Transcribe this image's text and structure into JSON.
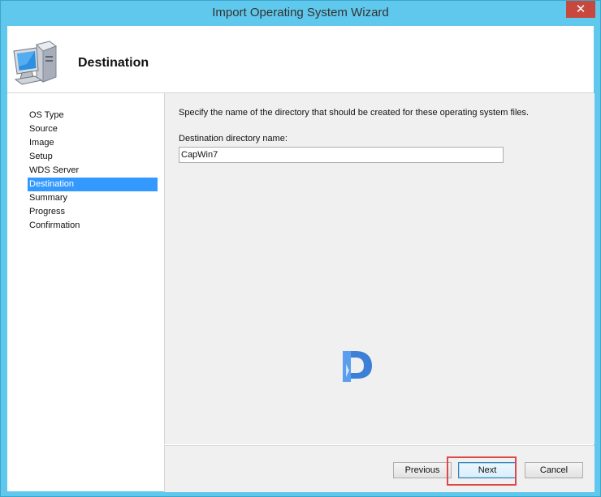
{
  "window": {
    "title": "Import Operating System Wizard",
    "close_glyph": "✕"
  },
  "header": {
    "title": "Destination",
    "icon": "computer-icon"
  },
  "nav": {
    "items": [
      {
        "label": "OS Type",
        "active": false
      },
      {
        "label": "Source",
        "active": false
      },
      {
        "label": "Image",
        "active": false
      },
      {
        "label": "Setup",
        "active": false
      },
      {
        "label": "WDS Server",
        "active": false
      },
      {
        "label": "Destination",
        "active": true
      },
      {
        "label": "Summary",
        "active": false
      },
      {
        "label": "Progress",
        "active": false
      },
      {
        "label": "Confirmation",
        "active": false
      }
    ]
  },
  "content": {
    "instruction": "Specify the name of the directory that should be created for these operating system files.",
    "dest_label": "Destination directory name:",
    "dest_value": "CapWin7",
    "watermark_icon": "prajwal-logo-icon"
  },
  "footer": {
    "previous_label": "Previous",
    "next_label": "Next",
    "cancel_label": "Cancel"
  },
  "colors": {
    "frame": "#5fc8ec",
    "selection": "#3399ff",
    "close": "#c7483d",
    "highlight": "#e0474a"
  }
}
